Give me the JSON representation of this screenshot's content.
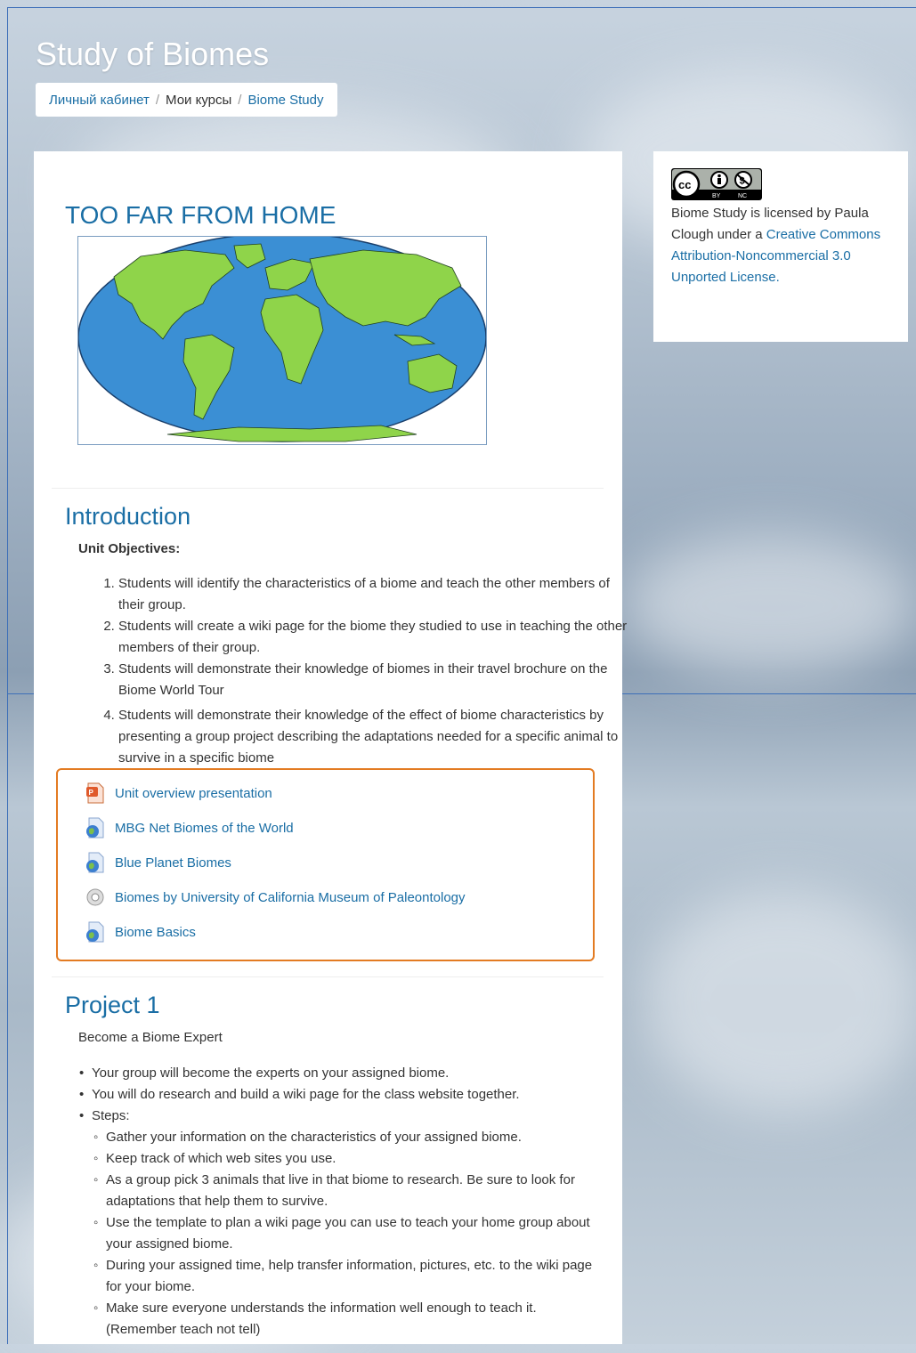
{
  "site": {
    "title": "Study of Biomes"
  },
  "breadcrumb": {
    "items": [
      "Личный кабинет",
      "Мои курсы",
      "Biome Study"
    ],
    "sep": "/"
  },
  "banner": {
    "title": "TOO FAR FROM HOME"
  },
  "license": {
    "badge": "cc by nc",
    "text_prefix": "Biome Study  is licensed by Paula Clough under a ",
    "link_text": "Creative Commons Attribution-Noncommercial 3.0 Unported License."
  },
  "introduction": {
    "heading": "Introduction",
    "objectives_label": "Unit Objectives:",
    "objectives": [
      "Students will identify the characteristics of a biome and teach the other members of their group.",
      "Students will create a wiki page for the biome they studied to use in teaching the other members of their group.",
      "Students will demonstrate their knowledge of biomes in their travel brochure on the Biome World Tour",
      "Students will demonstrate their knowledge of the effect of biome characteristics by presenting a group project describing the adaptations needed for a specific animal to survive in a specific biome"
    ],
    "resources": [
      {
        "label": "Unit overview presentation",
        "icon": "powerpoint-icon"
      },
      {
        "label": "MBG Net Biomes of the World",
        "icon": "globe-icon"
      },
      {
        "label": "Blue Planet Biomes",
        "icon": "globe-icon"
      },
      {
        "label": "Biomes by University of California Museum of Paleontology",
        "icon": "gear-icon"
      },
      {
        "label": "Biome Basics",
        "icon": "globe-icon"
      }
    ]
  },
  "project1": {
    "heading": "Project 1",
    "subtitle": "Become a Biome Expert",
    "bullets": [
      "Your group will become the experts on your assigned biome.",
      "You will do research and build a wiki page for the class website together.",
      "Steps:"
    ],
    "steps": [
      "Gather your information on the characteristics of your assigned biome.",
      "Keep track of which web sites you use.",
      "As a group pick 3 animals that live in that biome to research. Be sure to look for adaptations that help them to survive.",
      "Use the template to plan a wiki page you can use to teach your home group about your assigned biome.",
      "During your assigned time, help transfer information, pictures, etc. to the wiki page for your biome.",
      "Make sure everyone understands the information well enough to teach it. (Remember teach not tell)"
    ]
  },
  "colors": {
    "link": "#1a6ea5",
    "accent_border": "#e37b22",
    "frame": "#3d6fb8"
  }
}
